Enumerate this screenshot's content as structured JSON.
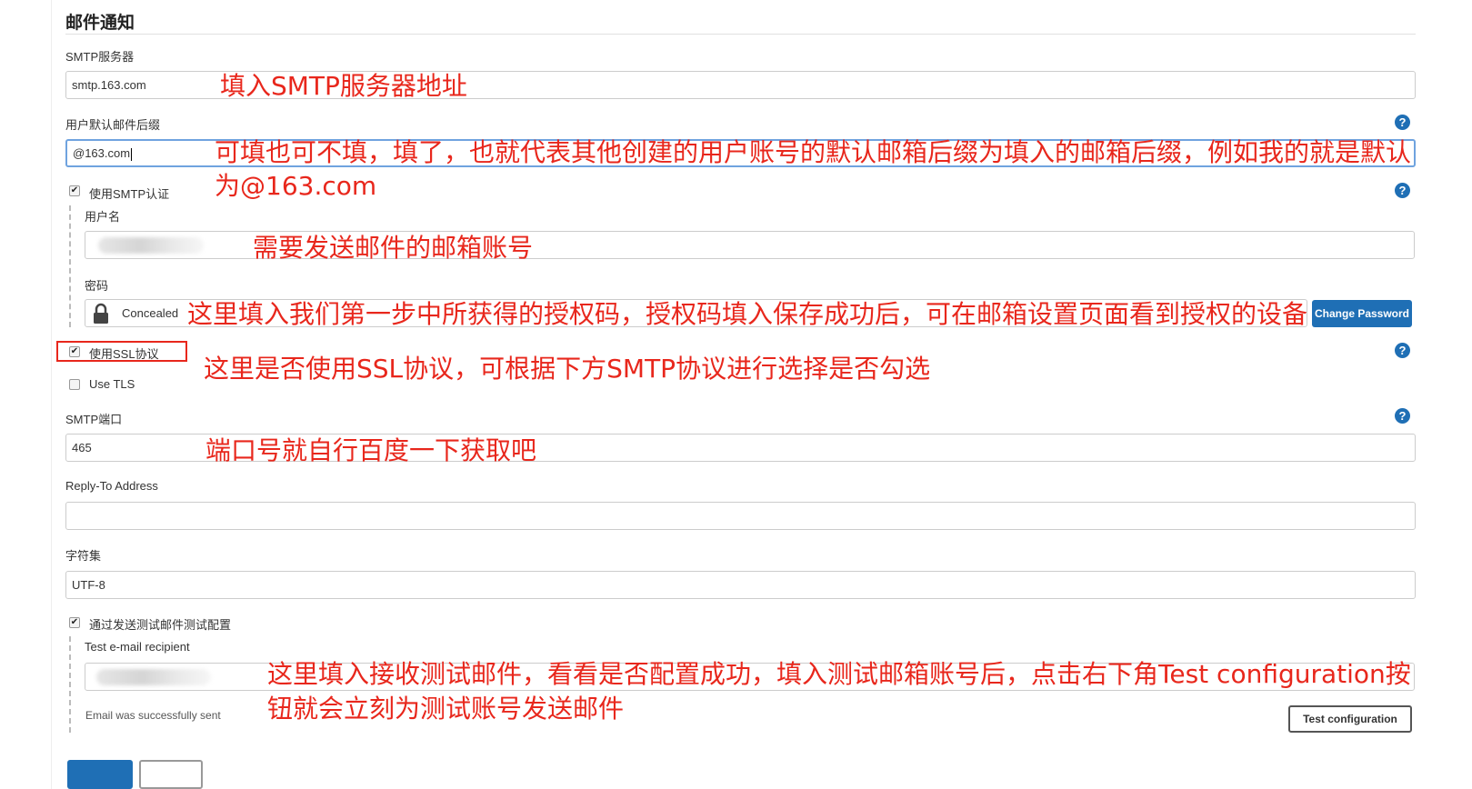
{
  "section": {
    "title": "邮件通知"
  },
  "smtp_server": {
    "label": "SMTP服务器",
    "value": "smtp.163.com"
  },
  "default_suffix": {
    "label": "用户默认邮件后缀",
    "value": "@163.com"
  },
  "smtp_auth": {
    "label": "使用SMTP认证",
    "checked": true
  },
  "username": {
    "label": "用户名",
    "value": ""
  },
  "password": {
    "label": "密码",
    "value": "Concealed",
    "change_button": "Change Password"
  },
  "ssl": {
    "label": "使用SSL协议",
    "checked": true
  },
  "tls": {
    "label": "Use TLS",
    "checked": false
  },
  "smtp_port": {
    "label": "SMTP端口",
    "value": "465"
  },
  "reply_to": {
    "label": "Reply-To Address",
    "value": ""
  },
  "charset": {
    "label": "字符集",
    "value": "UTF-8"
  },
  "test_mail": {
    "label": "通过发送测试邮件测试配置",
    "checked": true,
    "recipient_label": "Test e-mail recipient",
    "recipient_value": "",
    "status": "Email was successfully sent",
    "button": "Test configuration"
  },
  "help_icon": "?",
  "annotations": {
    "smtp_server": "填入SMTP服务器地址",
    "suffix_line1": "可填也可不填，填了，也就代表其他创建的用户账号的默认邮箱后缀为填入的邮箱后缀，例如我的就是默认",
    "suffix_line2": "为@163.com",
    "username": "需要发送邮件的邮箱账号",
    "password": "这里填入我们第一步中所获得的授权码，授权码填入保存成功后，可在邮箱设置页面看到授权的设备",
    "ssl": "这里是否使用SSL协议，可根据下方SMTP协议进行选择是否勾选",
    "port": "端口号就自行百度一下获取吧",
    "test_line1": "这里填入接收测试邮件，看看是否配置成功，填入测试邮箱账号后，点击右下角Test configuration按",
    "test_line2": "钮就会立刻为测试账号发送邮件"
  },
  "colors": {
    "accent": "#1f6fb5",
    "annotation": "#e8271c",
    "focus": "#6fa3df"
  }
}
